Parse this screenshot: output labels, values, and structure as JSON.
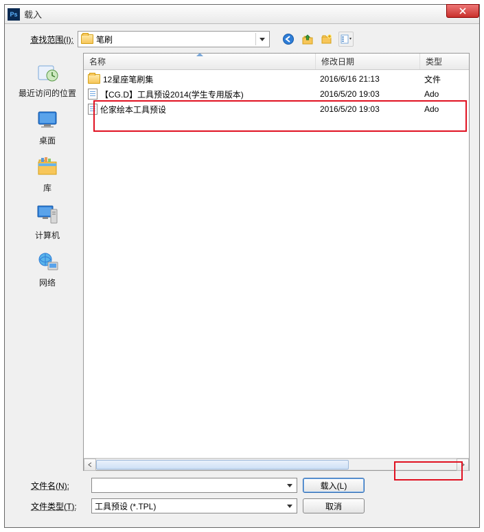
{
  "window": {
    "title": "载入"
  },
  "lookin": {
    "label": "查找范围(I):",
    "value": "笔刷"
  },
  "sidebar": {
    "items": [
      {
        "label": "最近访问的位置"
      },
      {
        "label": "桌面"
      },
      {
        "label": "库"
      },
      {
        "label": "计算机"
      },
      {
        "label": "网络"
      }
    ]
  },
  "columns": {
    "name": "名称",
    "date": "修改日期",
    "type": "类型"
  },
  "files": [
    {
      "name": "12星座笔刷集",
      "date": "2016/6/16 21:13",
      "type": "文件",
      "icon": "folder"
    },
    {
      "name": "【CG.D】工具预设2014(学生专用版本)",
      "date": "2016/5/20 19:03",
      "type": "Ado",
      "icon": "file"
    },
    {
      "name": "伦家绘本工具预设",
      "date": "2016/5/20 19:03",
      "type": "Ado",
      "icon": "file"
    }
  ],
  "bottom": {
    "filename_label": "文件名(N):",
    "filename_value": "",
    "filetype_label": "文件类型(T):",
    "filetype_value": "工具预设 (*.TPL)",
    "load_btn": "载入(L)",
    "cancel_btn": "取消"
  }
}
